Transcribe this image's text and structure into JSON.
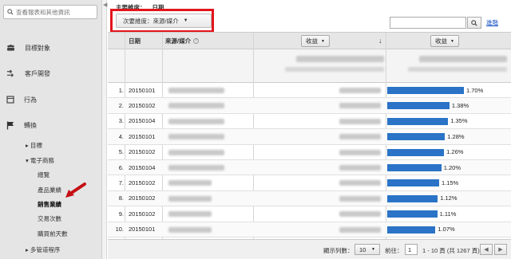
{
  "sidebar": {
    "search_placeholder": "查看報表和其他資訊",
    "nav": [
      {
        "label": "目標對象",
        "icon": "people-icon"
      },
      {
        "label": "客戶開發",
        "icon": "acquisition-arrows-icon"
      },
      {
        "label": "行為",
        "icon": "behavior-window-icon"
      },
      {
        "label": "轉換",
        "icon": "flag-icon"
      }
    ],
    "sub": {
      "goals": "目標",
      "ecommerce": "電子商務",
      "overview": "總覽",
      "product_performance": "產品業績",
      "sales_performance": "銷售業績",
      "transactions": "交易次數",
      "time_to_purchase": "購買前天數",
      "multi_channel": "多管道程序"
    }
  },
  "main": {
    "primary_dimension_label": "主要維度：",
    "primary_dimension_value": "日期",
    "secondary_dimension_button": "次要維度：來源/媒介",
    "advanced_link": "進階",
    "columns": {
      "date": "日期",
      "source_medium": "來源/媒介",
      "revenue_1": "收益",
      "revenue_2": "收益"
    },
    "rows": [
      {
        "n": "1.",
        "date": "20150101",
        "pct": "1.70%",
        "value": 1.7
      },
      {
        "n": "2.",
        "date": "20150102",
        "pct": "1.38%",
        "value": 1.38
      },
      {
        "n": "3.",
        "date": "20150104",
        "pct": "1.35%",
        "value": 1.35
      },
      {
        "n": "4.",
        "date": "20150101",
        "pct": "1.28%",
        "value": 1.28
      },
      {
        "n": "5.",
        "date": "20150102",
        "pct": "1.26%",
        "value": 1.26
      },
      {
        "n": "6.",
        "date": "20150104",
        "pct": "1.20%",
        "value": 1.2
      },
      {
        "n": "7.",
        "date": "20150102",
        "pct": "1.15%",
        "value": 1.15
      },
      {
        "n": "8.",
        "date": "20150102",
        "pct": "1.12%",
        "value": 1.12
      },
      {
        "n": "9.",
        "date": "20150102",
        "pct": "1.11%",
        "value": 1.11
      },
      {
        "n": "10.",
        "date": "20150101",
        "pct": "1.07%",
        "value": 1.07
      }
    ],
    "footer": {
      "rows_label": "顯示列數：",
      "rows_value": "10",
      "goto_label": "前往：",
      "goto_value": "1",
      "range": "1 - 10 頁 (共 1267 頁)"
    }
  },
  "colors": {
    "bar": "#2a73c6",
    "highlight": "#e2151c"
  }
}
